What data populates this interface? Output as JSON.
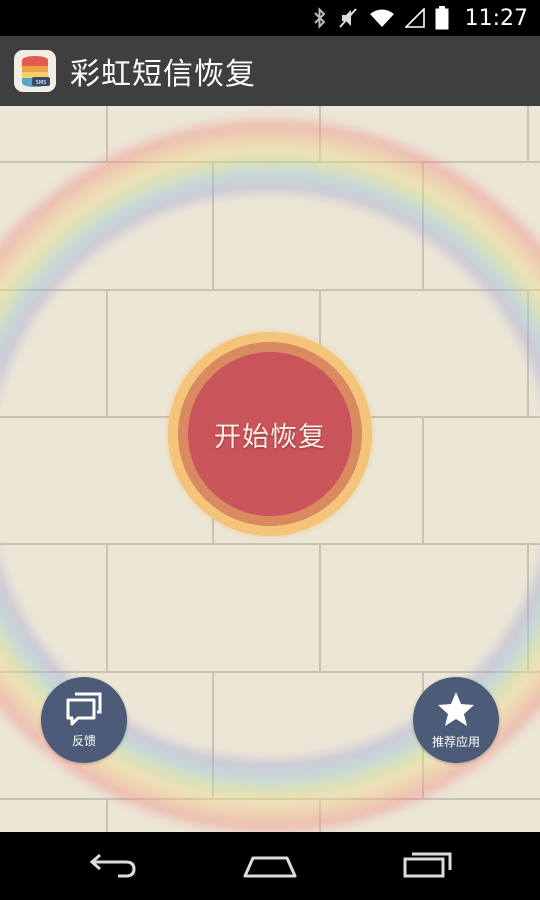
{
  "status_bar": {
    "time": "11:27",
    "icons": [
      "bluetooth-icon",
      "mute-vibrate-icon",
      "wifi-icon",
      "signal-icon",
      "battery-icon"
    ]
  },
  "action_bar": {
    "title": "彩虹短信恢复",
    "icon": "rainbow-db-app-icon"
  },
  "main": {
    "start_label": "开始恢复",
    "feedback_label": "反馈",
    "recommend_label": "推荐应用",
    "feedback_icon": "chat-bubbles-icon",
    "recommend_icon": "star-icon"
  },
  "nav_bar": {
    "icons": [
      "back-icon",
      "home-icon",
      "recent-apps-icon"
    ]
  },
  "colors": {
    "action_bar": "#3f3f3f",
    "background": "#ebe6d6",
    "start_button": "#c9545a",
    "start_ring_inner": "#d98a60",
    "start_ring_outer": "#f3c47a",
    "round_button": "#4c5c78"
  }
}
